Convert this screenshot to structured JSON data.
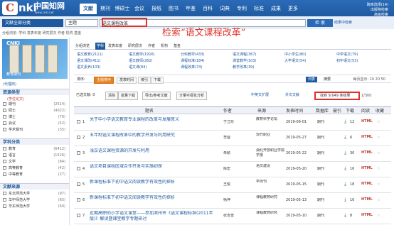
{
  "logo": {
    "initial": "C",
    "rest": "nki",
    "cn": "中国知网",
    "url": "www.cnki.net"
  },
  "nav": {
    "tabs": [
      "文献",
      "期刊",
      "博硕士",
      "会议",
      "报纸",
      "图书",
      "年鉴",
      "百科",
      "词典",
      "专利",
      "标准",
      "成果",
      "更多>>"
    ],
    "active_index": 0
  },
  "top_links": {
    "line1": "跨库选择(14)",
    "line2": "出版物检索",
    "line3": "高级检索"
  },
  "search": {
    "scope": "文献全部分类",
    "field": "主题",
    "query": "语文课程改革",
    "button": "检 索",
    "adv": "结果中检索"
  },
  "breadcrumb": "分组浏览: 学科 发表年度 研究层次 作者 机构 基金",
  "annotation": "检索“语文课程改革”",
  "ad": {
    "title": "CNKI",
    "subtitle": "教育期刊",
    "label": "(代理商)"
  },
  "left": {
    "sections": [
      {
        "title": "资源类型",
        "sub": "(学位论文)",
        "items": [
          {
            "label": "期刊",
            "count": "(2514)"
          },
          {
            "label": "硕士",
            "count": "(4022)"
          },
          {
            "label": "博士",
            "count": "(76)"
          },
          {
            "label": "会议",
            "count": "(52)"
          },
          {
            "label": "学术辑刊",
            "count": "(35)"
          }
        ]
      },
      {
        "title": "学科分类",
        "sub": "",
        "items": [
          {
            "label": "教育",
            "count": "(6412)"
          },
          {
            "label": "语言",
            "count": "(1526)"
          },
          {
            "label": "文学",
            "count": "(84)"
          },
          {
            "label": "高等教育",
            "count": "(42)"
          },
          {
            "label": "中等教育",
            "count": "(27)"
          }
        ]
      },
      {
        "title": "文献来源",
        "sub": "",
        "items": [
          {
            "label": "东北师范大学",
            "count": "(97)"
          },
          {
            "label": "华中师范大学",
            "count": "(65)"
          },
          {
            "label": "华东师范大学",
            "count": "(60)"
          }
        ]
      }
    ]
  },
  "groups": {
    "tabs": [
      "分组浏览",
      "学科",
      "发表年度",
      "研究层次",
      "作者",
      "机构",
      "基金"
    ],
    "active_index": 1,
    "facets": [
      "语文教育(2111)",
      "语文教学(1916)",
      "分科教学(433)",
      "语文课程(367)",
      "中小学生(80)",
      "中学语文(79)",
      "语文课改(411)",
      "语文教师(262)",
      "课程标准(184)",
      "课堂教学(103)",
      "大学语文(54)",
      "初中语文(53)",
      "语文素养(103)",
      "语文课(84)",
      "课程改革(74)",
      "教学改革(39)"
    ]
  },
  "sort": {
    "label": "排序:",
    "options": [
      "主题排序",
      "发表时间",
      "被引",
      "下载"
    ],
    "active_index": 0,
    "list_btns": [
      "列表",
      "摘要"
    ],
    "display": "每页显示: 10 20 50"
  },
  "tools": {
    "selected": "已选文献: 0",
    "items": [
      "清除",
      "批量下载",
      "导出/参考文献",
      "计量可视化分析"
    ],
    "extras": [
      "中英文扩展",
      "外文文献"
    ],
    "result_count": "找到 9,649 条结果",
    "pager": "1/300"
  },
  "table": {
    "headers": [
      "题名",
      "作者",
      "来源",
      "发表时间",
      "数据库",
      "被引",
      "下载",
      "阅读",
      "收藏"
    ],
    "rows": [
      {
        "no": "1",
        "title": "关于中小学语文教育专业课程的改革与发展意义",
        "author": "于立珍",
        "source": "教育科学论坛",
        "date": "2019-06-01",
        "db": "期刊",
        "cite": "",
        "dl": "12"
      },
      {
        "no": "2",
        "title": "五年制语文课程改革中的教学开发与利用研究",
        "author": "李蓉",
        "source": "现代职业",
        "date": "2019-05-27",
        "db": "期刊",
        "cite": "",
        "dl": "6"
      },
      {
        "no": "3",
        "title": "浅议语文课程资源的开发与利用",
        "author": "朱颖",
        "source": "湖北开放职业学院学报",
        "date": "2019-05-22",
        "db": "期刊",
        "cite": "",
        "dl": "30"
      },
      {
        "no": "4",
        "title": "语文项目课程区域合作开发与实施初探",
        "author": "陈宏",
        "source": "语文建设",
        "date": "2019-05-20",
        "db": "期刊",
        "cite": "",
        "dl": "16"
      },
      {
        "no": "5",
        "title": "新课程标准下初中语文阅读教学有效性的探析",
        "author": "王俊",
        "source": "学周刊",
        "date": "2019-05-15",
        "db": "期刊",
        "cite": "",
        "dl": "18"
      },
      {
        "no": "6",
        "title": "新课程标准下初中语文阅读教学有效性的探析",
        "author": "杨萍",
        "source": "课程教育研究",
        "date": "2019-05-13",
        "db": "期刊",
        "cite": "",
        "dl": "10"
      },
      {
        "no": "7",
        "title": "近期高职的小学语文课堂——参加滨州市《语文课程标准(2011年版)》解读暨课堂教学专题研讨",
        "author": "张吉雪",
        "source": "课程教育研究",
        "date": "2019-05-10",
        "db": "期刊",
        "cite": "",
        "dl": "8"
      }
    ]
  },
  "colors": {
    "brand": "#1f5aa0",
    "highlight": "#e0312a",
    "active_sort": "#e8821e"
  }
}
